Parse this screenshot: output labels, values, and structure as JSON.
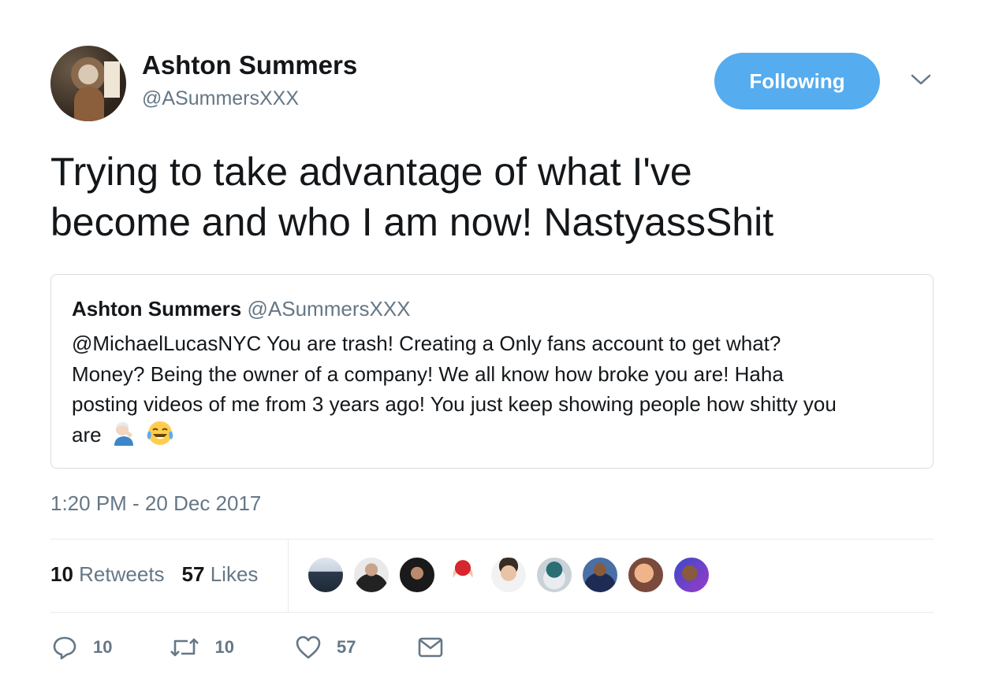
{
  "author": {
    "name": "Ashton Summers",
    "handle": "@ASummersXXX"
  },
  "follow_button": {
    "label": "Following",
    "color": "#55acee"
  },
  "tweet": {
    "line1": "Trying to take advantage of what I've",
    "line2": "become and who I am now! NastyassShit"
  },
  "quoted_tweet": {
    "name": "Ashton Summers",
    "handle": "@ASummersXXX",
    "line1": "@MichaelLucasNYC  You are trash! Creating a Only fans account to get what?",
    "line2": "Money? Being the owner of a company! We all know how broke you are! Haha",
    "line3": "posting videos of me from 3 years ago! You just keep showing people how shitty you",
    "line4": "are",
    "emojis": [
      "facepalm-emoji",
      "tears-of-joy-emoji"
    ]
  },
  "timestamp": "1:20 PM - 20 Dec 2017",
  "stats": {
    "retweets_count": "10",
    "retweets_label": "Retweets",
    "likes_count": "57",
    "likes_label": "Likes"
  },
  "liker_avatars": [
    "liker-1",
    "liker-2",
    "liker-3",
    "liker-4",
    "liker-5",
    "liker-6",
    "liker-7",
    "liker-8",
    "liker-9"
  ],
  "actions": {
    "replies": "10",
    "retweets": "10",
    "likes": "57"
  },
  "colors": {
    "text": "#14171a",
    "secondary": "#657786",
    "border": "#e6ecf0",
    "accent": "#55acee"
  }
}
